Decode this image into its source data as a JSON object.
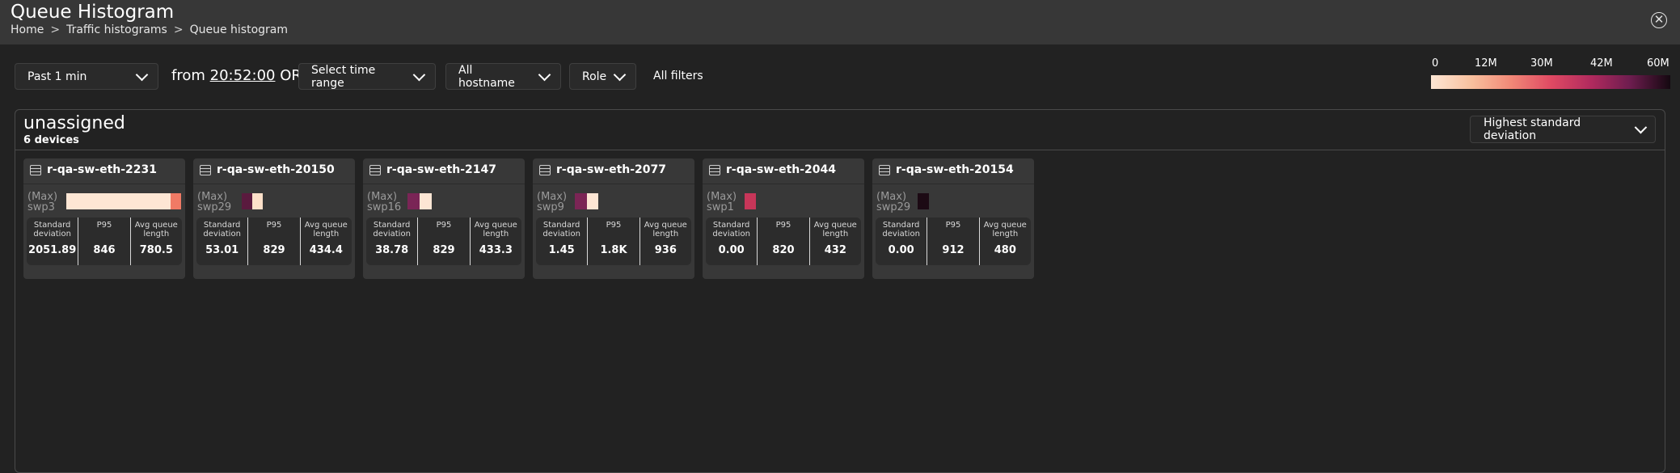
{
  "header": {
    "title": "Queue Histogram",
    "breadcrumb": [
      "Home",
      "Traffic histograms",
      "Queue histogram"
    ],
    "breadcrumb_sep": ">"
  },
  "filters": {
    "time_preset": "Past 1 min",
    "from_prefix": "from",
    "from_time": "20:52:00",
    "or_label": "OR",
    "time_range": "Select time range",
    "hostname": "All hostname",
    "role": "Role",
    "all_filters": "All filters"
  },
  "legend": {
    "ticks": [
      "0",
      "12M",
      "30M",
      "42M",
      "60M"
    ],
    "colors": [
      "#fde6d4",
      "#f8c09e",
      "#f28a78",
      "#e04a63",
      "#b02a5e",
      "#6e1d4f",
      "#140810"
    ]
  },
  "group": {
    "name": "unassigned",
    "count_label": "6 devices",
    "sort_label": "Highest standard deviation"
  },
  "stat_labels": {
    "std": "Standard deviation",
    "p95": "P95",
    "avg": "Avg queue length"
  },
  "devices": [
    {
      "name": "r-qa-sw-eth-2231",
      "max_label": "(Max)",
      "port": "swp3",
      "std": "2051.89",
      "p95": "846",
      "avg": "780.5",
      "heat": [
        "#fde6d4",
        "#fde6d4",
        "#fde6d4",
        "#fde6d4",
        "#fde6d4",
        "#fde6d4",
        "#fde6d4",
        "#fde6d4",
        "#fde6d4",
        "#fde6d4",
        "#f07a65"
      ]
    },
    {
      "name": "r-qa-sw-eth-20150",
      "max_label": "(Max)",
      "port": "swp29",
      "std": "53.01",
      "p95": "829",
      "avg": "434.4",
      "heat": [
        "#5a1a3e",
        "#fde0c9"
      ]
    },
    {
      "name": "r-qa-sw-eth-2147",
      "max_label": "(Max)",
      "port": "swp16",
      "std": "38.78",
      "p95": "829",
      "avg": "433.3",
      "heat": [
        "#7a2556",
        "#fde6d4"
      ]
    },
    {
      "name": "r-qa-sw-eth-2077",
      "max_label": "(Max)",
      "port": "swp9",
      "std": "1.45",
      "p95": "1.8K",
      "avg": "936",
      "heat": [
        "#7b2555",
        "#fde6d4"
      ]
    },
    {
      "name": "r-qa-sw-eth-2044",
      "max_label": "(Max)",
      "port": "swp1",
      "std": "0.00",
      "p95": "820",
      "avg": "432",
      "heat": [
        "#c73659"
      ]
    },
    {
      "name": "r-qa-sw-eth-20154",
      "max_label": "(Max)",
      "port": "swp29",
      "std": "0.00",
      "p95": "912",
      "avg": "480",
      "heat": [
        "#1c0a14"
      ]
    }
  ]
}
